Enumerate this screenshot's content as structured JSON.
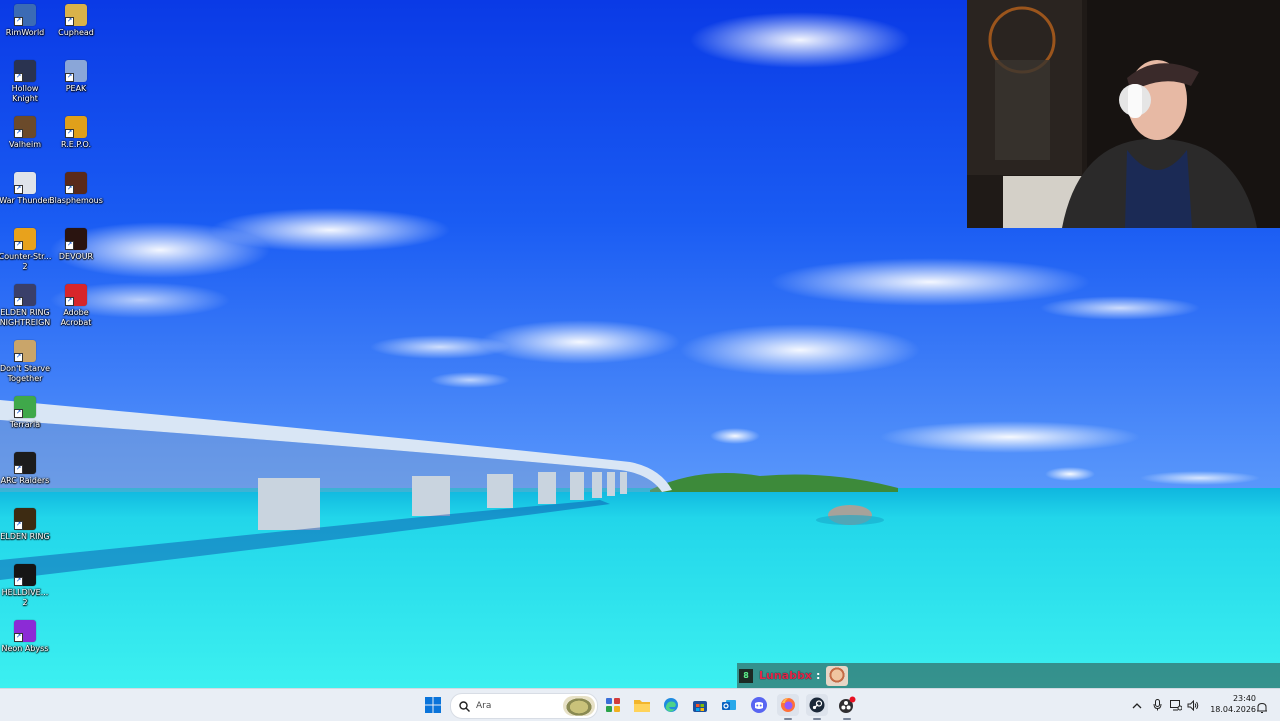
{
  "desktop": {
    "icons": [
      {
        "label": "RimWorld",
        "icon": "rimworld-icon",
        "color": "#3b6bb5"
      },
      {
        "label": "Cuphead",
        "icon": "cuphead-icon",
        "color": "#d9b24a"
      },
      {
        "label": "Hollow Knight",
        "icon": "hollow-knight-icon",
        "color": "#2a3350"
      },
      {
        "label": "PEAK",
        "icon": "peak-icon",
        "color": "#8aa6d8"
      },
      {
        "label": "Valheim",
        "icon": "valheim-icon",
        "color": "#6b4a2a"
      },
      {
        "label": "R.E.P.O.",
        "icon": "repo-icon",
        "color": "#e0a01a"
      },
      {
        "label": "War Thunder",
        "icon": "war-thunder-icon",
        "color": "#dfe3ea"
      },
      {
        "label": "Blasphemous",
        "icon": "blasphemous-icon",
        "color": "#5a2a1a"
      },
      {
        "label": "Counter-Str... 2",
        "icon": "counter-strike-icon",
        "color": "#e8a21c"
      },
      {
        "label": "DEVOUR",
        "icon": "devour-icon",
        "color": "#2a1410"
      },
      {
        "label": "ELDEN RING NIGHTREIGN",
        "icon": "nightreign-icon",
        "color": "#3a3f6a"
      },
      {
        "label": "Adobe Acrobat",
        "icon": "acrobat-icon",
        "color": "#d7262b"
      },
      {
        "label": "Don't Starve Together",
        "icon": "dont-starve-icon",
        "color": "#c9a56a"
      },
      {
        "label": "Terraria",
        "icon": "terraria-icon",
        "color": "#3fa84a"
      },
      {
        "label": "ARC Raiders",
        "icon": "arc-raiders-icon",
        "color": "#1c1c1c"
      },
      {
        "label": "ELDEN RING",
        "icon": "elden-ring-icon",
        "color": "#3d2b12"
      },
      {
        "label": "HELLDIVE... 2",
        "icon": "helldivers-icon",
        "color": "#151515"
      },
      {
        "label": "Neon Abyss",
        "icon": "neon-abyss-icon",
        "color": "#8c2bd6"
      }
    ]
  },
  "chat_overlay": {
    "badge": "8",
    "username": "Lunabbx",
    "separator": ":",
    "emote": "face-emote"
  },
  "taskbar": {
    "search_placeholder": "Ara",
    "apps": [
      {
        "name": "start-button",
        "icon": "windows-logo-icon"
      },
      {
        "name": "widgets-button",
        "icon": "widgets-icon"
      },
      {
        "name": "file-explorer-button",
        "icon": "folder-icon"
      },
      {
        "name": "edge-button",
        "icon": "edge-icon"
      },
      {
        "name": "store-button",
        "icon": "store-icon"
      },
      {
        "name": "outlook-button",
        "icon": "outlook-icon"
      },
      {
        "name": "discord-button",
        "icon": "discord-icon"
      },
      {
        "name": "firefox-button",
        "icon": "firefox-icon"
      },
      {
        "name": "steam-button",
        "icon": "steam-icon"
      },
      {
        "name": "obs-button",
        "icon": "obs-icon"
      }
    ],
    "clock": {
      "time": "23:40",
      "date": "18.04.2026"
    }
  },
  "colors": {
    "sky_top": "#0a3fe8",
    "sky_bottom": "#4f8dfa",
    "sea": "#2ee6f0",
    "taskbar": "#e9eef5",
    "chat_username": "#e0284a"
  }
}
